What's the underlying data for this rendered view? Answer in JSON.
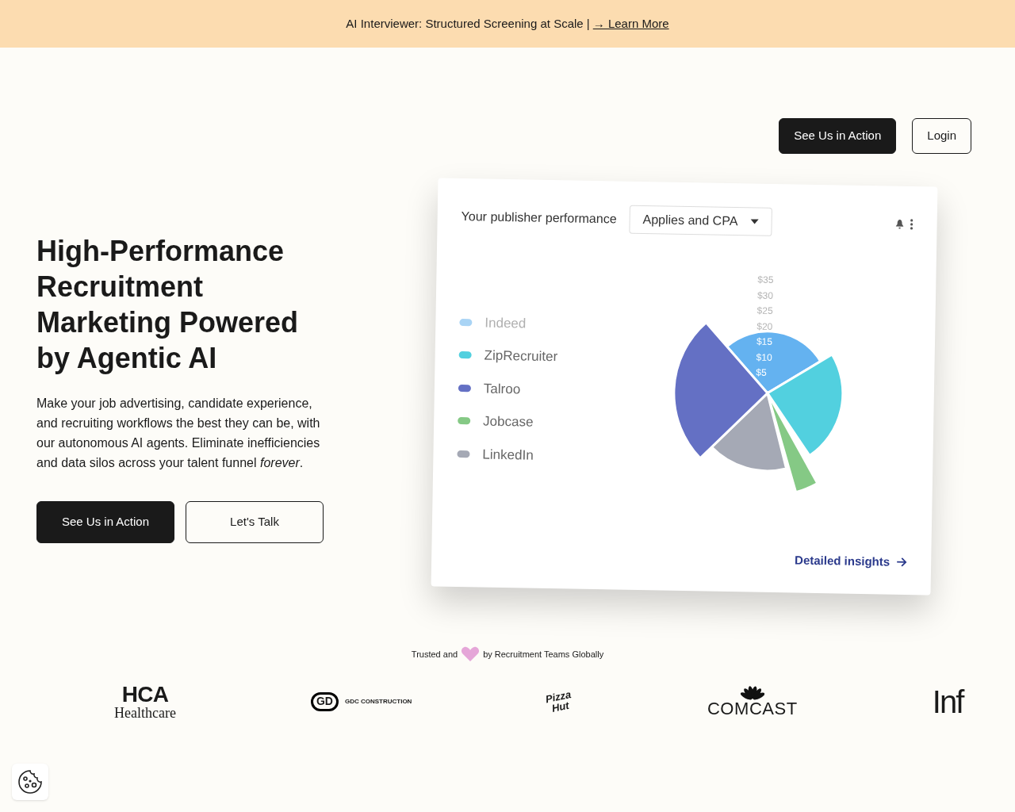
{
  "banner": {
    "text": "AI Interviewer: Structured Screening at Scale |",
    "link": "→ Learn More"
  },
  "header": {
    "buttons": [
      {
        "label": "See Us in Action",
        "kind": "primary"
      },
      {
        "label": "Login",
        "kind": "outline"
      }
    ]
  },
  "hero": {
    "title": "High-Performance Recruitment Marketing Powered by Agentic AI",
    "body": "Make your job advertising, candidate experience, and recruiting workflows the best they can be, with our autonomous AI agents. Eliminate inefficiencies and data silos across your talent funnel *forever*.",
    "buttons": [
      {
        "label": "See Us in Action",
        "kind": "primary"
      },
      {
        "label": "Let's Talk",
        "kind": "outline"
      }
    ]
  },
  "card": {
    "title": "Your publisher performance",
    "dropdown": "Applies and CPA",
    "link": "Detailed insights",
    "legend": [
      {
        "label": "Indeed",
        "color": "#a9d4f5",
        "disabled": true
      },
      {
        "label": "ZipRecruiter",
        "color": "#52d0df",
        "disabled": false
      },
      {
        "label": "Talroo",
        "color": "#6470c4",
        "disabled": false
      },
      {
        "label": "Jobcase",
        "color": "#85c985",
        "disabled": false
      },
      {
        "label": "LinkedIn",
        "color": "#a5a9b5",
        "disabled": false
      }
    ],
    "scale_labels": [
      "$35",
      "$30",
      "$25",
      "$20",
      "$15",
      "$10",
      "$5"
    ]
  },
  "trusted": {
    "before": "Trusted and",
    "after": "by Recruitment Teams Globally"
  },
  "logos": [
    {
      "kind": "hca",
      "text": "HCA",
      "sub": "Healthcare"
    },
    {
      "kind": "gdc",
      "text": "GD",
      "sub": "GDC CONSTRUCTION"
    },
    {
      "kind": "pizza",
      "text": "Pizza",
      "sub": "Hut"
    },
    {
      "kind": "comcast",
      "text": "COMCAST"
    },
    {
      "kind": "plain",
      "text": "Inf"
    }
  ]
}
